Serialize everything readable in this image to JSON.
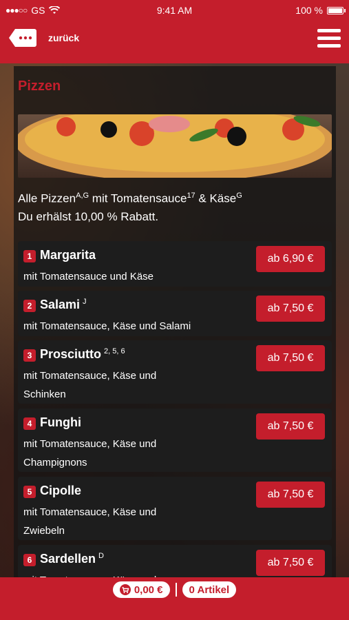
{
  "status": {
    "carrier": "GS",
    "time": "9:41 AM",
    "battery": "100 %"
  },
  "nav": {
    "back_label": "zurück"
  },
  "section": {
    "title": "Pizzen",
    "intro_line1": "Alle Pizzen",
    "intro_sup1": "A,G",
    "intro_mid": " mit Tomatensauce",
    "intro_sup2": "17",
    "intro_and": " & Käse",
    "intro_sup3": "G",
    "intro_line2": "Du erhälst 10,00 % Rabatt."
  },
  "items": [
    {
      "num": "1",
      "name": "Margarita",
      "sup": "",
      "desc": "mit Tomatensauce und Käse",
      "price": "ab 6,90 €"
    },
    {
      "num": "2",
      "name": "Salami",
      "sup": "J",
      "desc": "mit Tomatensauce, Käse und Salami",
      "price": "ab 7,50 €"
    },
    {
      "num": "3",
      "name": "Prosciutto",
      "sup": "2, 5, 6",
      "desc": "mit Tomatensauce, Käse und Schinken",
      "price": "ab 7,50 €"
    },
    {
      "num": "4",
      "name": "Funghi",
      "sup": "",
      "desc": "mit Tomatensauce, Käse und Champignons",
      "price": "ab 7,50 €"
    },
    {
      "num": "5",
      "name": "Cipolle",
      "sup": "",
      "desc": "mit Tomatensauce, Käse und Zwiebeln",
      "price": "ab 7,50 €"
    },
    {
      "num": "6",
      "name": "Sardellen",
      "sup": "D",
      "desc": "mit Tomatensauce, Käse und",
      "price": "ab 7,50 €"
    }
  ],
  "footer": {
    "cart_total": "0,00 €",
    "article_count": "0 Artikel"
  },
  "colors": {
    "brand": "#c41e2c"
  }
}
